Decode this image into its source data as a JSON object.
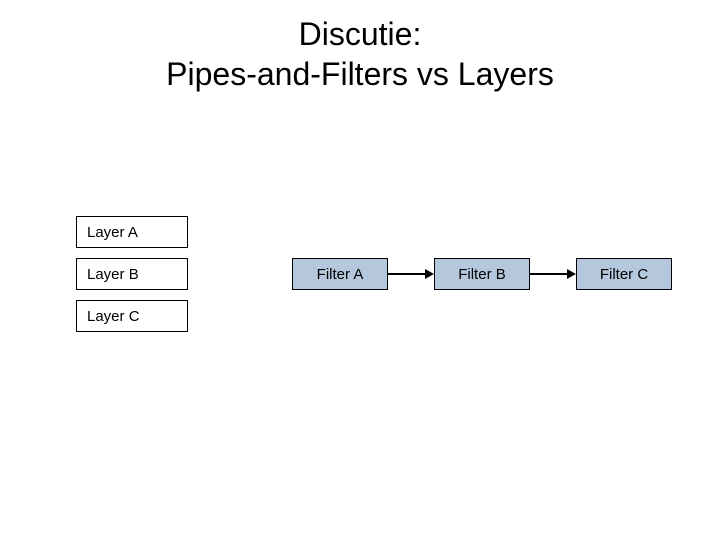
{
  "title": {
    "line1": "Discutie:",
    "line2": "Pipes-and-Filters vs Layers"
  },
  "layers": {
    "items": [
      {
        "label": "Layer A"
      },
      {
        "label": "Layer B"
      },
      {
        "label": "Layer C"
      }
    ]
  },
  "filters": {
    "items": [
      {
        "label": "Filter A"
      },
      {
        "label": "Filter B"
      },
      {
        "label": "Filter C"
      }
    ]
  },
  "colors": {
    "filter_fill": "#b4c7dc",
    "border": "#000000",
    "background": "#ffffff"
  }
}
